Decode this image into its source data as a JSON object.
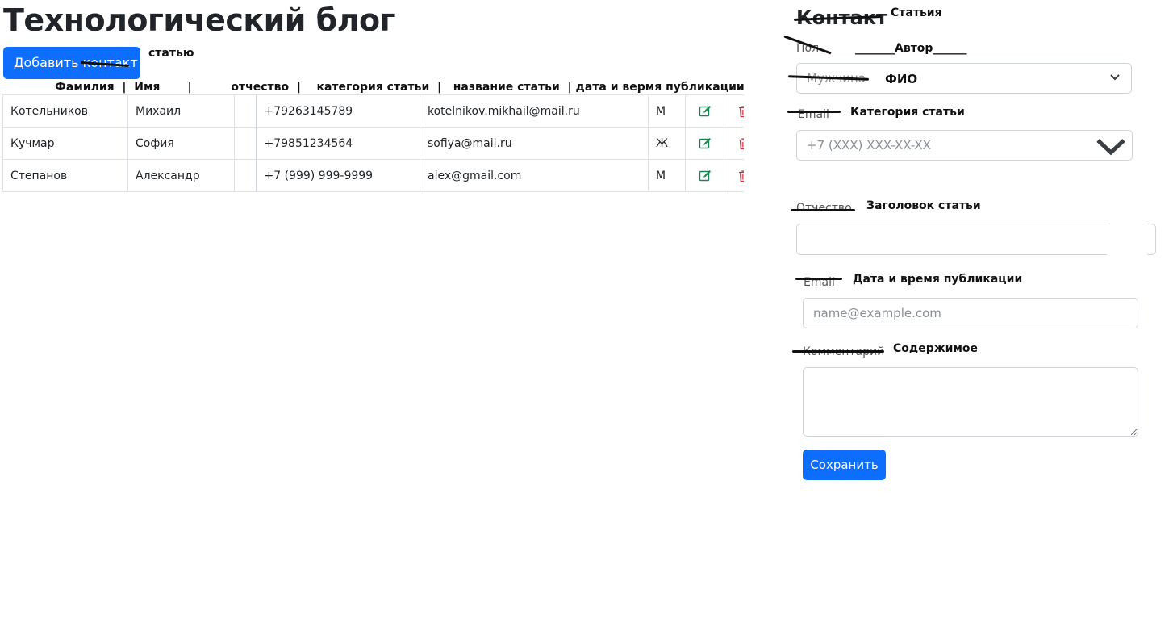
{
  "header": {
    "title": "Технологический блог"
  },
  "toolbar": {
    "add_label": "Добавить контакт",
    "add_note": "статью"
  },
  "table": {
    "column_note": "Фамилия  |  Имя       |          отчество  |    категория статьи  |   название статьи  | дата и вермя публикации",
    "rows": [
      {
        "last": "Котельников",
        "first": "Михаил",
        "middle": "",
        "phone": "+79263145789",
        "email": "kotelnikov.mikhail@mail.ru",
        "gender": "М"
      },
      {
        "last": "Кучмар",
        "first": "София",
        "middle": "",
        "phone": "+79851234564",
        "email": "sofiya@mail.ru",
        "gender": "Ж"
      },
      {
        "last": "Степанов",
        "first": "Александр",
        "middle": "",
        "phone": "+7 (999) 999-9999",
        "email": "alex@gmail.com",
        "gender": "М"
      }
    ]
  },
  "form": {
    "heading_orig": "Контакт",
    "heading_note": "Статьия",
    "gender_label_orig": "Пол",
    "gender_note": "_______Автор______",
    "gender_value": "Мужчина",
    "gender_value_note": "ФИО",
    "phone_label_orig": "Email",
    "phone_note": "Категория статьи",
    "phone_placeholder": "+7 (XXX) XXX-XX-XX",
    "patronymic_label_orig": "Отчество",
    "patronymic_note": "Заголовок статьи",
    "email_label_orig": "Email",
    "email_note": "Дата и время публикации",
    "email_placeholder": "name@example.com",
    "comment_label_orig": "Комментарий",
    "comment_note": "Содержимое",
    "save_label": "Сохранить"
  },
  "colors": {
    "primary": "#0d6efd",
    "edit_icon": "#198754",
    "delete_icon": "#dc3545",
    "annotation": "#111111"
  }
}
